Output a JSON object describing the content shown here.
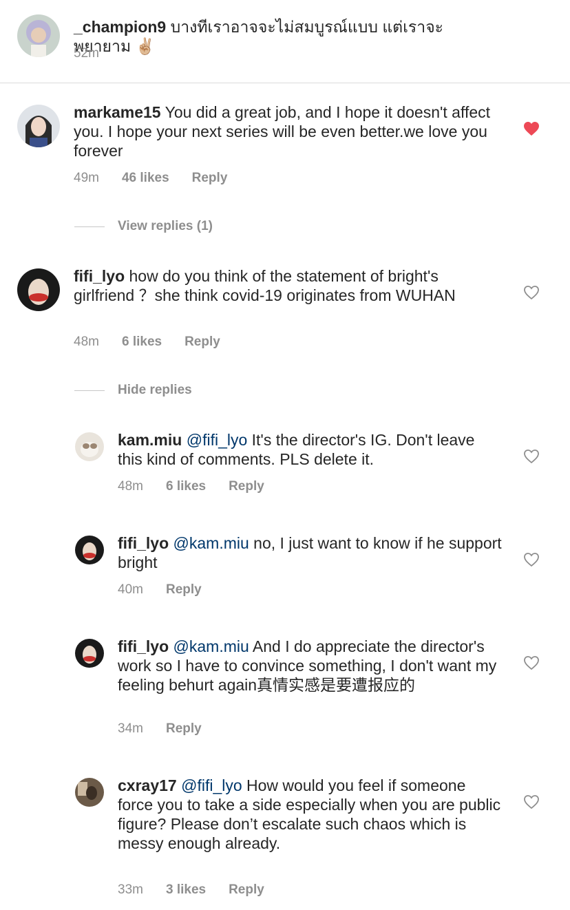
{
  "caption": {
    "username": "_champion9",
    "text": "บางทีเราอาจจะไม่สมบูรณ์แบบ แต่เราจะพยายาม ✌🏼",
    "time": "52m"
  },
  "comments": [
    {
      "username": "markame15",
      "text": "You did a great job, and I hope it doesn't affect you. I hope your next series will be even better.we love you forever",
      "time": "49m",
      "likes": "46 likes",
      "reply": "Reply",
      "liked": true,
      "toggle": "View replies (1)"
    },
    {
      "username": "fifi_lyo",
      "text": "how do you think of the  statement of bright's girlfriend ？she think covid-19 originates from WUHAN",
      "time": "48m",
      "likes": "6 likes",
      "reply": "Reply",
      "liked": false,
      "toggle": "Hide replies",
      "replies": [
        {
          "username": "kam.miu",
          "mention": "@fifi_lyo",
          "text": "It's the director's IG. Don't leave this kind of comments. PLS delete it.",
          "time": "48m",
          "likes": "6 likes",
          "reply": "Reply"
        },
        {
          "username": "fifi_lyo",
          "mention": "@kam.miu",
          "text": "no, I just want to know if he support bright",
          "time": "40m",
          "reply": "Reply"
        },
        {
          "username": "fifi_lyo",
          "mention": "@kam.miu",
          "text": "And I do appreciate the director's work so I have to convince something, I don't want my feeling behurt again真情实感是要遭报应的",
          "time": "34m",
          "reply": "Reply"
        },
        {
          "username": "cxray17",
          "mention": "@fifi_lyo",
          "text": "How would you feel if someone force you to take a side especially when you are public figure? Please don’t escalate such chaos which is messy enough already.",
          "time": "33m",
          "likes": "3 likes",
          "reply": "Reply"
        }
      ]
    }
  ],
  "icons": {
    "heart_outline": "heart-outline-icon",
    "heart_filled": "heart-filled-icon"
  },
  "colors": {
    "like_red": "#ed4956",
    "mention_blue": "#00376b",
    "meta_gray": "#8e8e8e"
  }
}
